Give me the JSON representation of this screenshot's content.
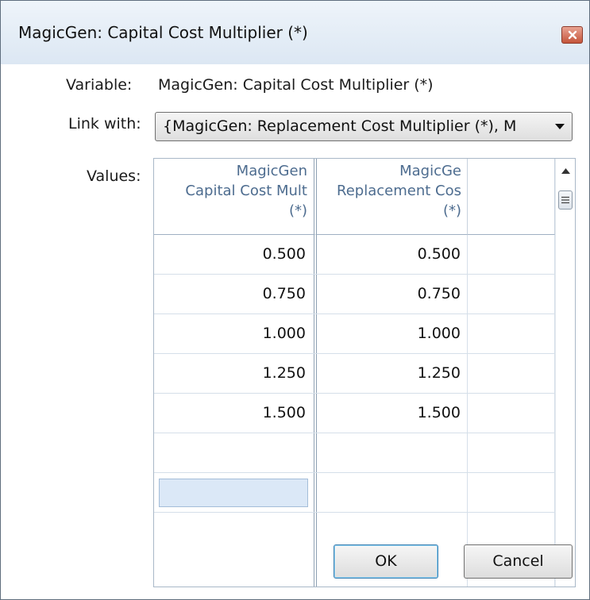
{
  "window": {
    "title": "MagicGen: Capital Cost Multiplier (*)",
    "close_icon": "close-icon"
  },
  "form": {
    "variable_label": "Variable:",
    "variable_value": "MagicGen: Capital Cost Multiplier (*)",
    "link_label": "Link with:",
    "link_value": "{MagicGen: Replacement Cost Multiplier (*), M",
    "values_label": "Values:"
  },
  "grid": {
    "columns": [
      {
        "line1": "MagicGen",
        "line2": "Capital Cost Mult",
        "line3": "(*)"
      },
      {
        "line1": "MagicGe",
        "line2": "Replacement Cos",
        "line3": "(*)"
      }
    ],
    "rows": [
      [
        "0.500",
        "0.500"
      ],
      [
        "0.750",
        "0.750"
      ],
      [
        "1.000",
        "1.000"
      ],
      [
        "1.250",
        "1.250"
      ],
      [
        "1.500",
        "1.500"
      ]
    ]
  },
  "buttons": {
    "ok": "OK",
    "cancel": "Cancel"
  },
  "colors": {
    "header_text": "#4d6c8f",
    "edit_cell": "#dbe8f7",
    "title_bar": "#dce7f3"
  }
}
